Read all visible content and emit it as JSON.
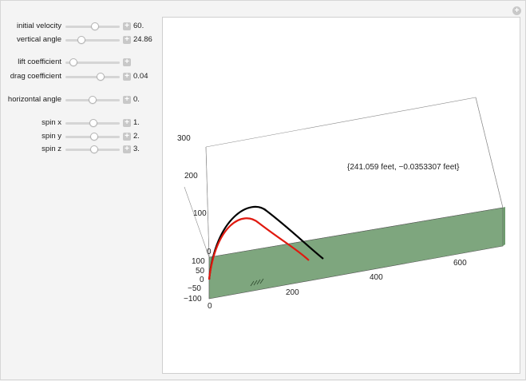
{
  "controls": [
    {
      "id": "initial-velocity",
      "label": "initial velocity",
      "value": "60.",
      "fraction": 0.55
    },
    {
      "id": "vertical-angle",
      "label": "vertical angle",
      "value": "24.86",
      "fraction": 0.3
    },
    {
      "id": "lift-coefficient",
      "label": "lift coefficient",
      "value": "",
      "fraction": 0.15
    },
    {
      "id": "drag-coefficient",
      "label": "drag coefficient",
      "value": "0.04",
      "fraction": 0.64
    },
    {
      "id": "horizontal-angle",
      "label": "horizontal angle",
      "value": "0.",
      "fraction": 0.5
    },
    {
      "id": "spin-x",
      "label": "spin x",
      "value": "1.",
      "fraction": 0.52
    },
    {
      "id": "spin-y",
      "label": "spin y",
      "value": "2.",
      "fraction": 0.53
    },
    {
      "id": "spin-z",
      "label": "spin z",
      "value": "3.",
      "fraction": 0.53
    }
  ],
  "plot": {
    "readout": "{241.059 feet, −0.0353307 feet}",
    "ground_color": "#7ea67e",
    "trajectory_colors": [
      "#000000",
      "#e0190f"
    ],
    "vertical_ticks": [
      "300",
      "200",
      "100",
      "0"
    ],
    "side_ticks": [
      "100",
      "50",
      "0",
      "−50",
      "−100"
    ],
    "front_ticks": [
      "0",
      "200"
    ],
    "far_ticks": [
      "400",
      "600"
    ]
  }
}
